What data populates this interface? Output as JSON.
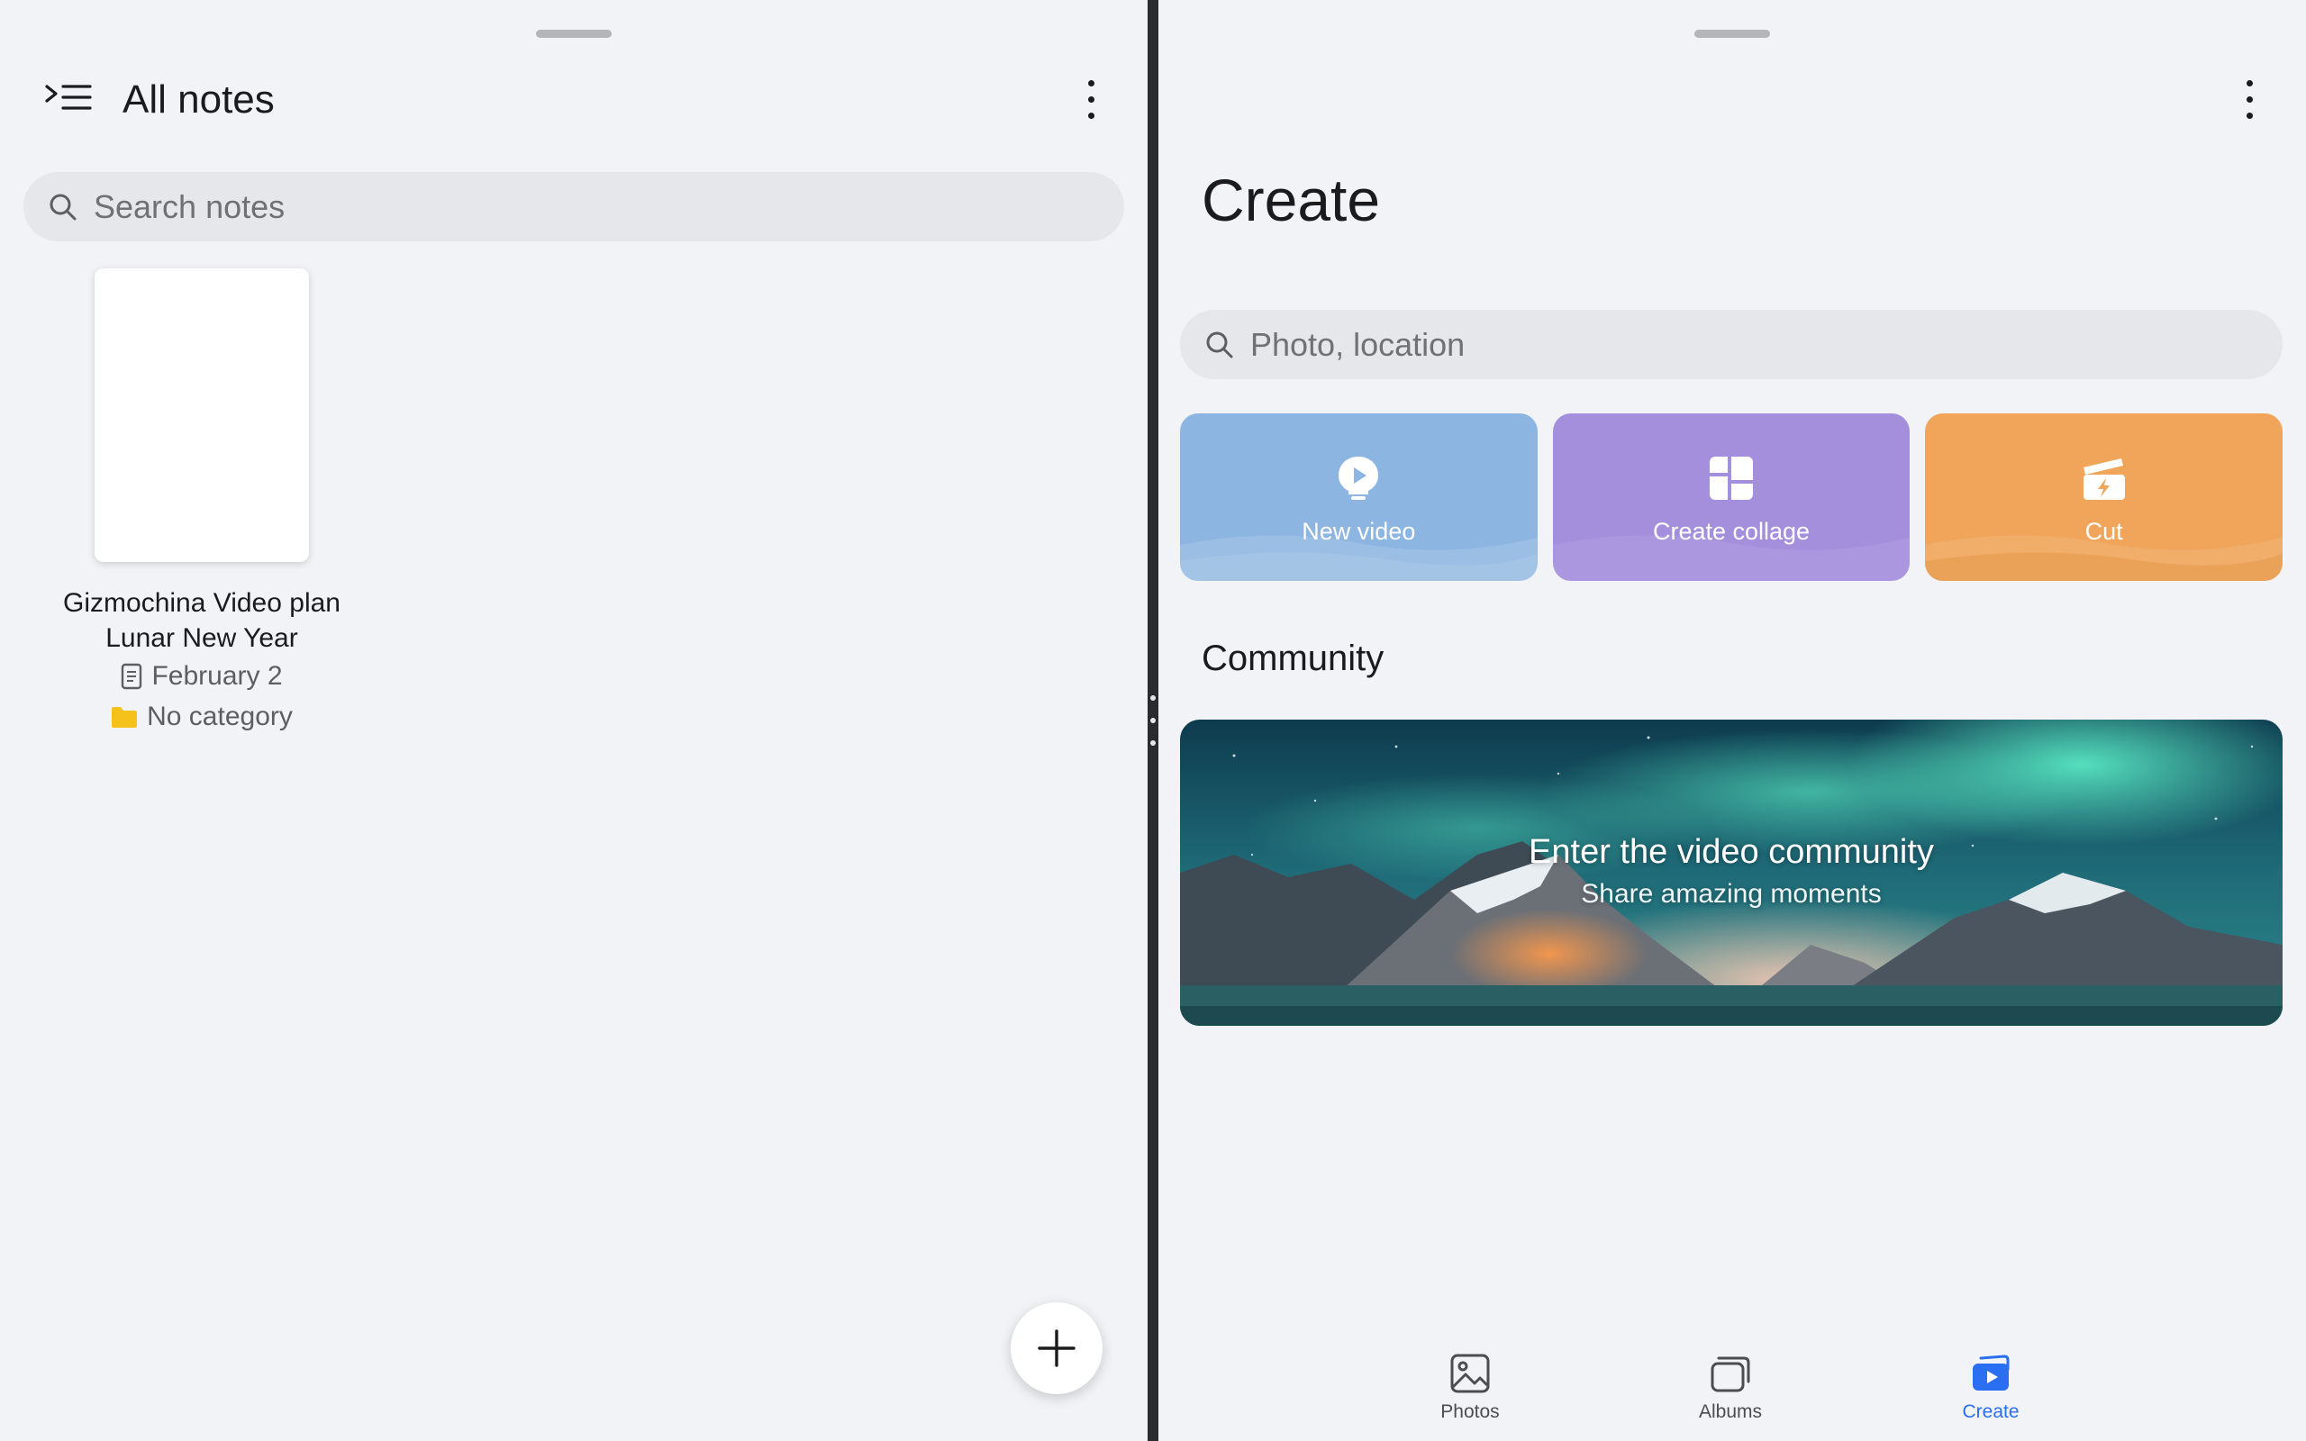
{
  "notes_app": {
    "title": "All notes",
    "search": {
      "placeholder": "Search notes"
    },
    "notes": [
      {
        "title_line1": "Gizmochina Video plan",
        "title_line2": "Lunar New Year",
        "date": "February 2",
        "category": "No category"
      }
    ],
    "icons": {
      "menu": "menu-collapse-icon",
      "more": "more-vertical-icon",
      "search": "search-icon",
      "date": "document-icon",
      "category": "folder-icon",
      "add": "plus-icon"
    },
    "colors": {
      "folder": "#f4c21a"
    }
  },
  "gallery_app": {
    "title": "Create",
    "search": {
      "placeholder": "Photo, location"
    },
    "actions": [
      {
        "label": "New video",
        "icon": "video-bulb-icon",
        "color": "#8db5e1"
      },
      {
        "label": "Create collage",
        "icon": "collage-icon",
        "color": "#a48fdd"
      },
      {
        "label": "Cut",
        "icon": "clapper-icon",
        "color": "#f0a55a"
      }
    ],
    "community": {
      "heading": "Community",
      "banner_title": "Enter the video community",
      "banner_subtitle": "Share amazing moments"
    },
    "nav": [
      {
        "label": "Photos",
        "icon": "photos-icon",
        "active": false
      },
      {
        "label": "Albums",
        "icon": "albums-icon",
        "active": false
      },
      {
        "label": "Create",
        "icon": "create-icon",
        "active": true
      }
    ],
    "colors": {
      "accent": "#2a6ff2"
    }
  }
}
